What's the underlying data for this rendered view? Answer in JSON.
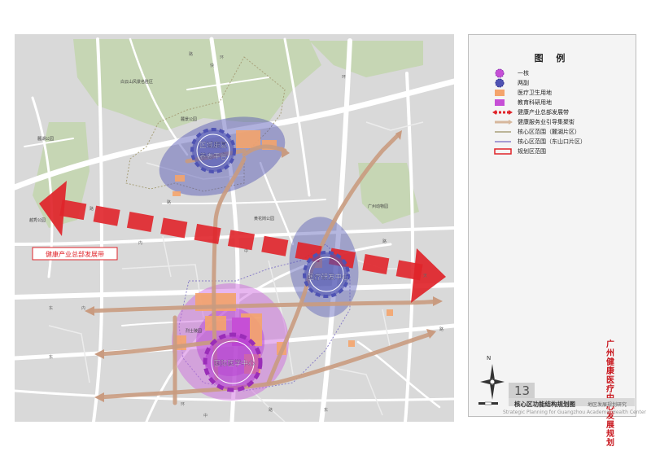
{
  "map": {
    "labels": {
      "belt": "健康产业总部发展带",
      "core_north": [
        "区域康复",
        "养老平台"
      ],
      "core_east": "医疗研发中心",
      "core_south": "国际医学中心"
    },
    "place_names": [
      "白云山风景名胜区",
      "麓湖公园",
      "麓景公园",
      "越秀公园",
      "黄花岗公园",
      "广州动物园",
      "烈士陵园"
    ],
    "road_chars": [
      "路",
      "环",
      "快",
      "路",
      "东",
      "路",
      "内",
      "中",
      "环",
      "路",
      "内",
      "东",
      "环",
      "天",
      "路",
      "东",
      "路",
      "中"
    ]
  },
  "legend": {
    "title": "图 例",
    "items": [
      {
        "label": "一核",
        "symbol": "one-core-icon"
      },
      {
        "label": "两副",
        "symbol": "two-sub-icon"
      },
      {
        "label": "医疗卫生用地",
        "symbol": "medical-land-icon",
        "color": "#f4a46c"
      },
      {
        "label": "教育科研用地",
        "symbol": "education-land-icon",
        "color": "#c64fd6"
      },
      {
        "label": "健康产业总部发展带",
        "symbol": "industry-belt-icon",
        "color": "#e0242a"
      },
      {
        "label": "健康服务业引导集聚街",
        "symbol": "service-street-icon",
        "color": "#d6b79c"
      },
      {
        "label": "核心区范围（麓湖片区）",
        "symbol": "core-luhu-icon",
        "color": "#a8a07a"
      },
      {
        "label": "核心区范围（东山口片区）",
        "symbol": "core-dongshankou-icon",
        "color": "#8a7fc8"
      },
      {
        "label": "规划区范围",
        "symbol": "plan-area-icon",
        "color": "#e0242a"
      }
    ]
  },
  "plate": {
    "number": "13",
    "title": "核心区功能结构规划图",
    "subtitle": "地区发展规划研究",
    "english": "Strategic Planning for Guangzhou Academic Health Center",
    "north": "N",
    "side_title": [
      "广",
      "州",
      "健",
      "康",
      "医",
      "疗",
      "中",
      "心",
      "发",
      "展",
      "规",
      "划"
    ]
  },
  "colors": {
    "map_bg": "#d9d9d9",
    "road": "#ffffff",
    "green": "#c6d6b4",
    "orange_arrow": "#e8b18a",
    "red_belt": "#e0242a",
    "purple": "#cc66dd",
    "blue": "#4f53b3"
  }
}
